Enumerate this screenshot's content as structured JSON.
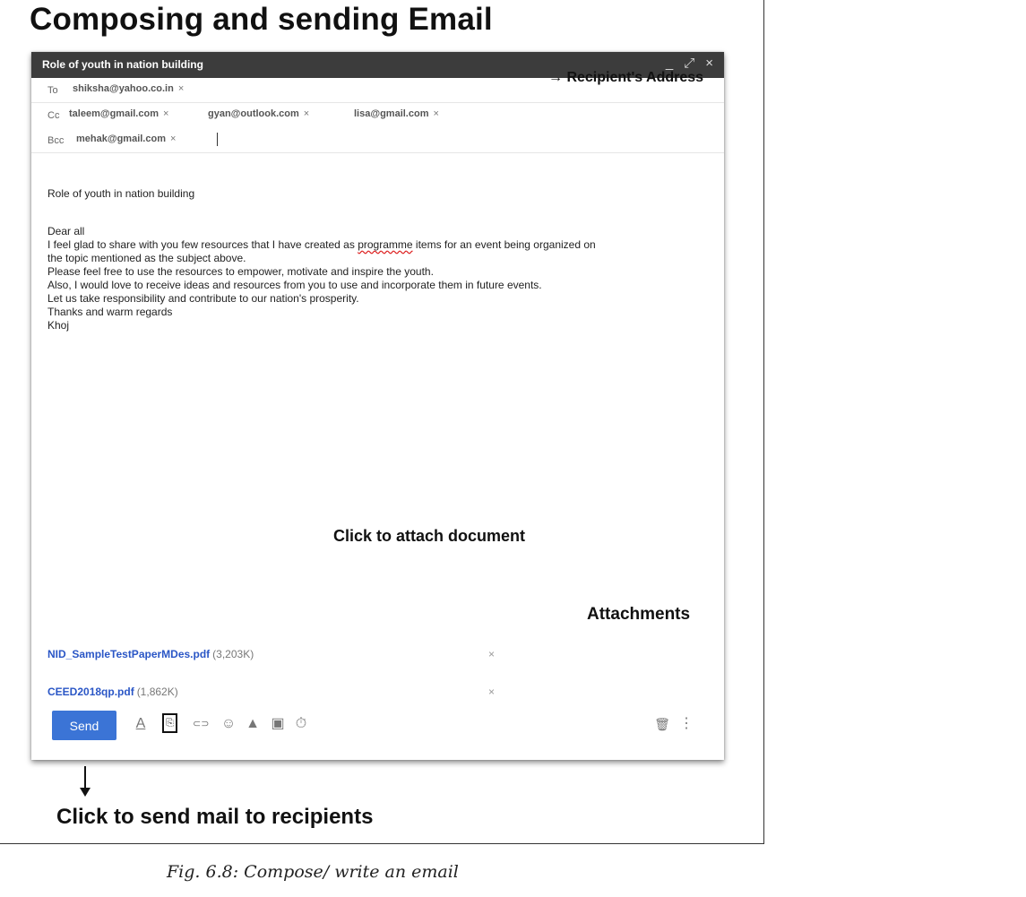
{
  "heading": "Composing and sending Email",
  "window": {
    "title": "Role of youth in nation building",
    "minimize": "_",
    "expand": "⤢",
    "close": "×"
  },
  "to": {
    "label": "To",
    "chips": [
      "shiksha@yahoo.co.in"
    ]
  },
  "cc": {
    "label": "Cc",
    "chips": [
      "taleem@gmail.com",
      "gyan@outlook.com",
      "lisa@gmail.com"
    ]
  },
  "bcc": {
    "label": "Bcc",
    "chips": [
      "mehak@gmail.com"
    ]
  },
  "chip_remove": "×",
  "recipient_note": "→ Recipient's Address",
  "subject": "Role of youth in nation building",
  "body": {
    "line1": "Dear all",
    "line2a": "I feel glad to share with you few resources that I have created as ",
    "line2b": "programme",
    "line2c": " items for an event being organized on",
    "line3": "the topic mentioned as the subject above.",
    "line4": "Please feel free to use the resources to empower, motivate and inspire the youth.",
    "line5": "Also, I would love to receive ideas and resources from you to use and incorporate them in future events.",
    "line6": "Let us take responsibility and contribute to our nation's prosperity.",
    "line7": "Thanks and warm regards",
    "line8": "Khoj"
  },
  "attach_note": "Click to attach document",
  "attachments_note": "Attachments",
  "attachments": [
    {
      "name": "NID_SampleTestPaperMDes.pdf",
      "size": "(3,203K)",
      "remove": "×"
    },
    {
      "name": "CEED2018qp.pdf",
      "size": "(1,862K)",
      "remove": "×"
    }
  ],
  "toolbar": {
    "send_label": "Send",
    "icons": [
      "format-text-icon",
      "attach-file-icon",
      "link-icon",
      "emoji-icon",
      "drive-icon",
      "photo-icon",
      "confidential-mode-icon",
      "delete-icon",
      "more-options-icon"
    ],
    "format_glyph": "A",
    "link_glyph": "⊂⊃",
    "emoji_glyph": "☺",
    "drive_glyph": "▲",
    "photo_glyph": "▣",
    "lock_glyph": "⏱",
    "trash_glyph": "🗑",
    "more_glyph": "⋮"
  },
  "send_note": "Click to send mail to recipients",
  "caption": "Fig. 6.8: Compose/ write an email"
}
